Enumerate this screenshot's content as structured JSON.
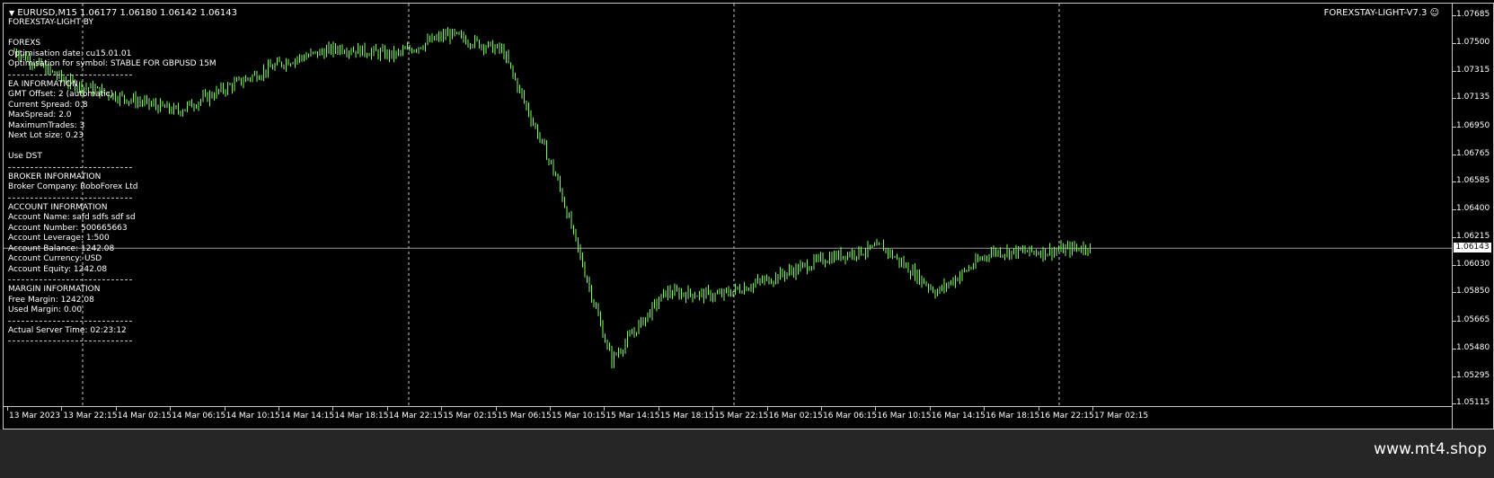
{
  "header": {
    "symbol_line": "EURUSD,M15  1.06177 1.06180 1.06142 1.06143",
    "ea_name": "FOREXSTAY-LIGHT-V7.3"
  },
  "info_panel": {
    "lines": [
      "FOREXSTAY-LIGHT BY",
      "",
      "FOREXS",
      "Optimisation date: cu15.01.01",
      "Optimisation for symbol: STABLE FOR GBPUSD 15M",
      "---",
      "EA INFORMATION",
      "GMT Offset: 2 (automatic)",
      "Current Spread:  0.8",
      "MaxSpread:  2.0",
      "MaximumTrades: 3",
      "Next Lot size: 0.23",
      "",
      "Use DST",
      "---",
      "BROKER INFORMATION",
      "Broker Company:   RoboForex Ltd",
      "---",
      "ACCOUNT INFORMATION",
      "Account Name:  safd   sdfs sdf  sd",
      "Account Number:   500665663",
      "Account Leverage: 1:500",
      "Account Balance:  1242.08",
      "Account Currency: USD",
      "Account Equity:   1242.08",
      "---",
      "MARGIN INFORMATION",
      "Free Margin:   1242.08",
      "Used Margin:   0.00",
      "---",
      "Actual Server Time: 02:23:12",
      "---"
    ]
  },
  "price_axis": {
    "labels": [
      "1.07685",
      "1.07500",
      "1.07315",
      "1.07135",
      "1.06950",
      "1.06765",
      "1.06585",
      "1.06400",
      "1.06215",
      "1.06030",
      "1.05850",
      "1.05665",
      "1.05480",
      "1.05295",
      "1.05115"
    ],
    "current_bid": "1.06143"
  },
  "time_axis": {
    "labels": [
      "13 Mar 2023",
      "13 Mar 22:15",
      "14 Mar 02:15",
      "14 Mar 06:15",
      "14 Mar 10:15",
      "14 Mar 14:15",
      "14 Mar 18:15",
      "14 Mar 22:15",
      "15 Mar 02:15",
      "15 Mar 06:15",
      "15 Mar 10:15",
      "15 Mar 14:15",
      "15 Mar 18:15",
      "15 Mar 22:15",
      "16 Mar 02:15",
      "16 Mar 06:15",
      "16 Mar 10:15",
      "16 Mar 14:15",
      "16 Mar 18:15",
      "16 Mar 22:15",
      "17 Mar 02:15"
    ]
  },
  "colors": {
    "background": "#000000",
    "candle": "#7cff5c",
    "grid": "#c8c8c8",
    "bottom_bar": "#262626"
  },
  "chart_data": {
    "type": "candlestick",
    "symbol": "EURUSD",
    "timeframe": "M15",
    "ylim": [
      1.05115,
      1.07685
    ],
    "key_points": [
      {
        "x": "13 Mar 2023",
        "y": 1.0745
      },
      {
        "x": "13 Mar 22:15",
        "y": 1.0724
      },
      {
        "x": "14 Mar 02:15",
        "y": 1.0714
      },
      {
        "x": "14 Mar 06:15",
        "y": 1.0705
      },
      {
        "x": "14 Mar 10:15",
        "y": 1.0722
      },
      {
        "x": "14 Mar 14:15",
        "y": 1.0738
      },
      {
        "x": "14 Mar 18:15",
        "y": 1.0747
      },
      {
        "x": "14 Mar 22:15",
        "y": 1.0742
      },
      {
        "x": "15 Mar 02:15",
        "y": 1.0756
      },
      {
        "x": "15 Mar 06:15",
        "y": 1.0745
      },
      {
        "x": "15 Mar 10:15",
        "y": 1.066
      },
      {
        "x": "15 Mar 14:15",
        "y": 1.054
      },
      {
        "x": "15 Mar 18:15",
        "y": 1.0585
      },
      {
        "x": "15 Mar 22:15",
        "y": 1.0583
      },
      {
        "x": "16 Mar 02:15",
        "y": 1.0595
      },
      {
        "x": "16 Mar 06:15",
        "y": 1.0608
      },
      {
        "x": "16 Mar 10:15",
        "y": 1.0615
      },
      {
        "x": "16 Mar 14:15",
        "y": 1.0585
      },
      {
        "x": "16 Mar 18:15",
        "y": 1.0612
      },
      {
        "x": "16 Mar 22:15",
        "y": 1.0612
      },
      {
        "x": "17 Mar 02:15",
        "y": 1.0616
      }
    ]
  },
  "footer": {
    "site": "www.mt4.shop"
  }
}
